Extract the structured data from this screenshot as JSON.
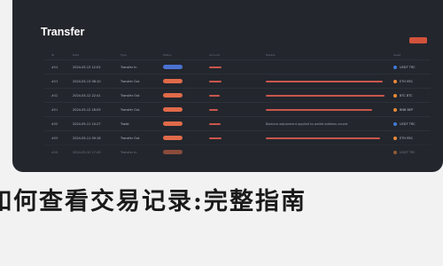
{
  "window": {
    "title": "Transfer"
  },
  "table": {
    "headers": [
      "ID",
      "Date",
      "Type",
      "Status",
      "Amount",
      "Details",
      "Asset"
    ],
    "rows": [
      {
        "id": "#04",
        "date": "2024-05-13 12:02",
        "type": "Transfer In",
        "status": "blue",
        "amount_bar": 0.34,
        "desc_bar": 0.0,
        "desc_text": "",
        "coin": "USDT TRC",
        "coin_color": "blue",
        "faint": false
      },
      {
        "id": "#03",
        "date": "2024-05-13 08:10",
        "type": "Transfer Out",
        "status": "red",
        "amount_bar": 0.34,
        "desc_bar": 0.94,
        "desc_text": "",
        "coin": "ETH ERC",
        "coin_color": "orange",
        "faint": false
      },
      {
        "id": "#02",
        "date": "2024-05-12 22:41",
        "type": "Transfer Out",
        "status": "red",
        "amount_bar": 0.3,
        "desc_bar": 0.96,
        "desc_text": "",
        "coin": "BTC BTC",
        "coin_color": "orange",
        "faint": false
      },
      {
        "id": "#01",
        "date": "2024-05-12 18:05",
        "type": "Transfer Out",
        "status": "red",
        "amount_bar": 0.26,
        "desc_bar": 0.86,
        "desc_text": "",
        "coin": "BNB BEP",
        "coin_color": "orange",
        "faint": false
      },
      {
        "id": "#00",
        "date": "2024-05-11 10:27",
        "type": "Trade",
        "status": "red",
        "amount_bar": 0.32,
        "desc_bar": 0.0,
        "desc_text": "Balance adjustment applied to wallet address record",
        "coin": "USDT TRC",
        "coin_color": "blue",
        "faint": false
      },
      {
        "id": "#09",
        "date": "2024-05-11 09:18",
        "type": "Transfer Out",
        "status": "red",
        "amount_bar": 0.36,
        "desc_bar": 0.92,
        "desc_text": "",
        "coin": "ETH ERC",
        "coin_color": "orange",
        "faint": false
      },
      {
        "id": "#08",
        "date": "2024-05-10 17:45",
        "type": "Transfer In",
        "status": "red",
        "amount_bar": 0.0,
        "desc_bar": 0.0,
        "desc_text": "",
        "coin": "USDT TRC",
        "coin_color": "orange",
        "faint": true
      }
    ]
  },
  "caption": "如何查看交易记录:完整指南"
}
